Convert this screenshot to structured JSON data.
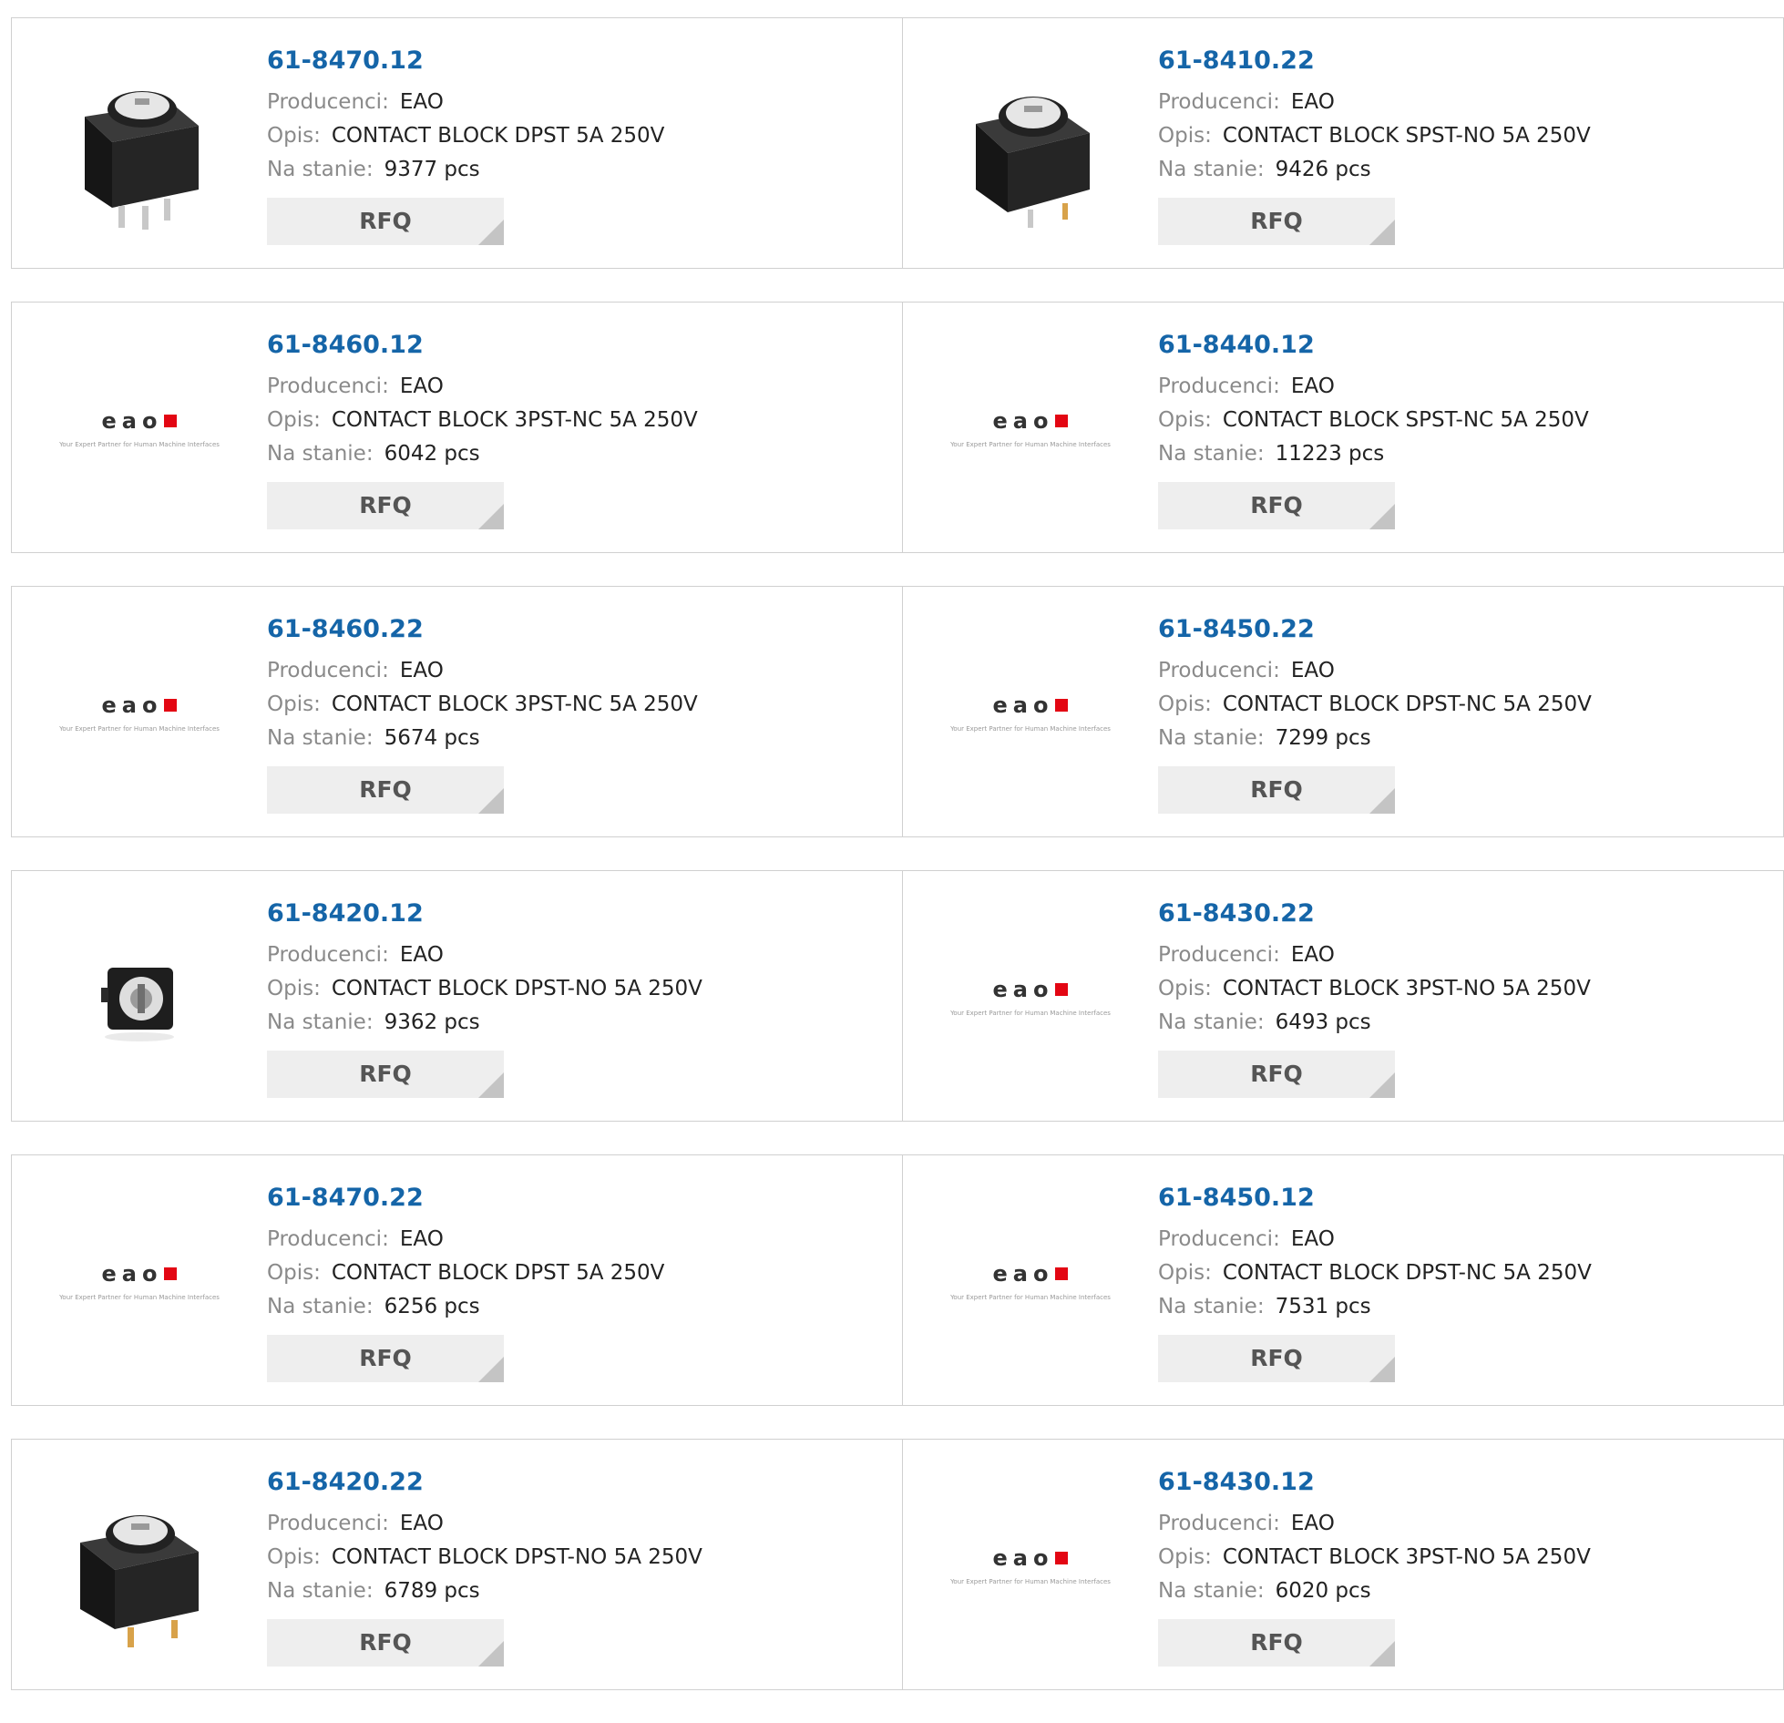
{
  "labels": {
    "manufacturer": "Producenci:",
    "description": "Opis:",
    "stock": "Na stanie:",
    "rfq": "RFQ"
  },
  "logo": {
    "word": "eao",
    "tagline": "Your Expert Partner for Human Machine Interfaces",
    "accent_color": "#e30613"
  },
  "colors": {
    "link": "#1565a8",
    "label": "#8a8a8a",
    "button_bg": "#eeeeee"
  },
  "products": [
    {
      "part": "61-8470.12",
      "manufacturer": "EAO",
      "description": "CONTACT BLOCK DPST 5A 250V",
      "stock": "9377 pcs",
      "image": "contact-block-photo"
    },
    {
      "part": "61-8410.22",
      "manufacturer": "EAO",
      "description": "CONTACT BLOCK SPST-NO 5A 250V",
      "stock": "9426 pcs",
      "image": "contact-block-photo"
    },
    {
      "part": "61-8460.12",
      "manufacturer": "EAO",
      "description": "CONTACT BLOCK 3PST-NC 5A 250V",
      "stock": "6042 pcs",
      "image": "eao-logo"
    },
    {
      "part": "61-8440.12",
      "manufacturer": "EAO",
      "description": "CONTACT BLOCK SPST-NC 5A 250V",
      "stock": "11223 pcs",
      "image": "eao-logo"
    },
    {
      "part": "61-8460.22",
      "manufacturer": "EAO",
      "description": "CONTACT BLOCK 3PST-NC 5A 250V",
      "stock": "5674 pcs",
      "image": "eao-logo"
    },
    {
      "part": "61-8450.22",
      "manufacturer": "EAO",
      "description": "CONTACT BLOCK DPST-NC 5A 250V",
      "stock": "7299 pcs",
      "image": "eao-logo"
    },
    {
      "part": "61-8420.12",
      "manufacturer": "EAO",
      "description": "CONTACT BLOCK DPST-NO 5A 250V",
      "stock": "9362 pcs",
      "image": "contact-block-small-photo"
    },
    {
      "part": "61-8430.22",
      "manufacturer": "EAO",
      "description": "CONTACT BLOCK 3PST-NO 5A 250V",
      "stock": "6493 pcs",
      "image": "eao-logo"
    },
    {
      "part": "61-8470.22",
      "manufacturer": "EAO",
      "description": "CONTACT BLOCK DPST 5A 250V",
      "stock": "6256 pcs",
      "image": "eao-logo"
    },
    {
      "part": "61-8450.12",
      "manufacturer": "EAO",
      "description": "CONTACT BLOCK DPST-NC 5A 250V",
      "stock": "7531 pcs",
      "image": "eao-logo"
    },
    {
      "part": "61-8420.22",
      "manufacturer": "EAO",
      "description": "CONTACT BLOCK DPST-NO 5A 250V",
      "stock": "6789 pcs",
      "image": "contact-block-photo"
    },
    {
      "part": "61-8430.12",
      "manufacturer": "EAO",
      "description": "CONTACT BLOCK 3PST-NO 5A 250V",
      "stock": "6020 pcs",
      "image": "eao-logo"
    }
  ]
}
